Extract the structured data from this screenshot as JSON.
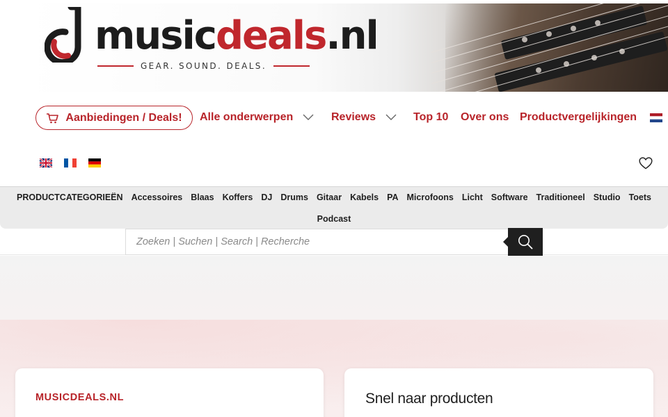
{
  "brand": {
    "logo_music": "music",
    "logo_deals": "deals",
    "logo_tld": ".nl",
    "tagline": "GEAR. SOUND. DEALS.",
    "accent_color": "#b8242a"
  },
  "nav": {
    "deals_label": "Aanbiedingen / Deals!",
    "all_topics_label": "Alle onderwerpen",
    "reviews_label": "Reviews",
    "top10_label": "Top 10",
    "about_label": "Over ons",
    "comparisons_label": "Productvergelijkingen",
    "icons": {
      "deals": "shopping-cart-icon",
      "dropdown": "chevron-down-icon",
      "wishlist": "heart-icon",
      "search": "search-icon"
    }
  },
  "languages": [
    "nl",
    "en",
    "fr",
    "de"
  ],
  "categories": {
    "heading": "PRODUCTCATEGORIEËN",
    "items": [
      "Accessoires",
      "Blaas",
      "Koffers",
      "DJ",
      "Drums",
      "Gitaar",
      "Kabels",
      "PA",
      "Microfoons",
      "Licht",
      "Software",
      "Traditioneel",
      "Studio",
      "Toets"
    ],
    "overflow_items": [
      "Podcast"
    ]
  },
  "search": {
    "placeholder": "Zoeken | Suchen | Search | Recherche",
    "value": ""
  },
  "cards": {
    "left_kicker": "MUSICDEALS.NL",
    "right_title": "Snel naar producten"
  }
}
